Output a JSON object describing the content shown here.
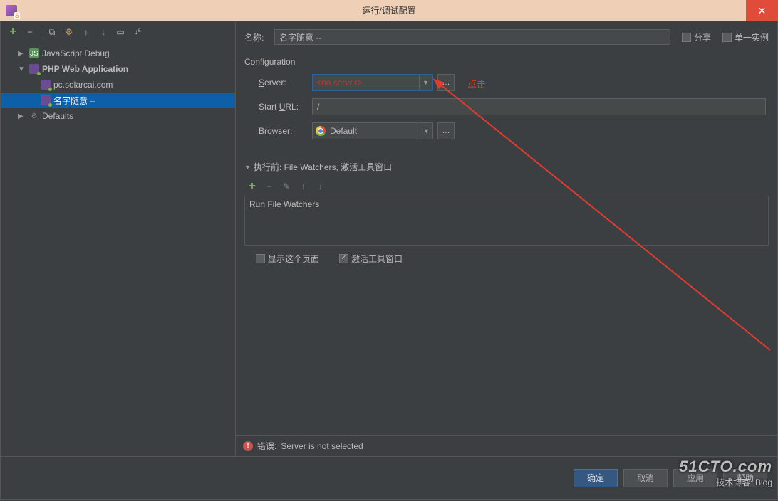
{
  "titlebar": {
    "title": "运行/调试配置"
  },
  "sidebar": {
    "toolbar_icons": [
      "plus",
      "minus",
      "copy",
      "wrench",
      "up",
      "down",
      "folder",
      "sort"
    ],
    "items": [
      {
        "label": "JavaScript Debug",
        "expander": "▶",
        "icon": "js"
      },
      {
        "label": "PHP Web Application",
        "expander": "▼",
        "icon": "php"
      },
      {
        "label": "pc.solarcai.com",
        "icon": "php",
        "level": 2
      },
      {
        "label": "名字随意 --",
        "icon": "php",
        "level": 2,
        "selected": true
      },
      {
        "label": "Defaults",
        "expander": "▶",
        "icon": "gear"
      }
    ]
  },
  "form": {
    "name_label": "名称:",
    "name_value": "名字随意 --",
    "share_label": "分享",
    "single_instance_label": "单一实例",
    "config_title": "Configuration",
    "server_label": "Server:",
    "server_value": "<no server>",
    "start_url_label": "Start URL:",
    "start_url_value": "/",
    "browser_label": "Browser:",
    "browser_value": "Default"
  },
  "before_launch": {
    "header": "执行前: File Watchers, 激活工具窗口",
    "item": "Run File Watchers",
    "show_page_label": "显示这个页面",
    "activate_tool_label": "激活工具窗口"
  },
  "error": {
    "label": "错误:",
    "msg": "Server is not selected"
  },
  "footer": {
    "ok": "确定",
    "cancel": "取消",
    "apply": "应用",
    "help": "帮助"
  },
  "annotation": {
    "text": "点击"
  },
  "watermark": {
    "big": "51CTO.com",
    "sub": "技术博客",
    "tag": "Blog"
  }
}
